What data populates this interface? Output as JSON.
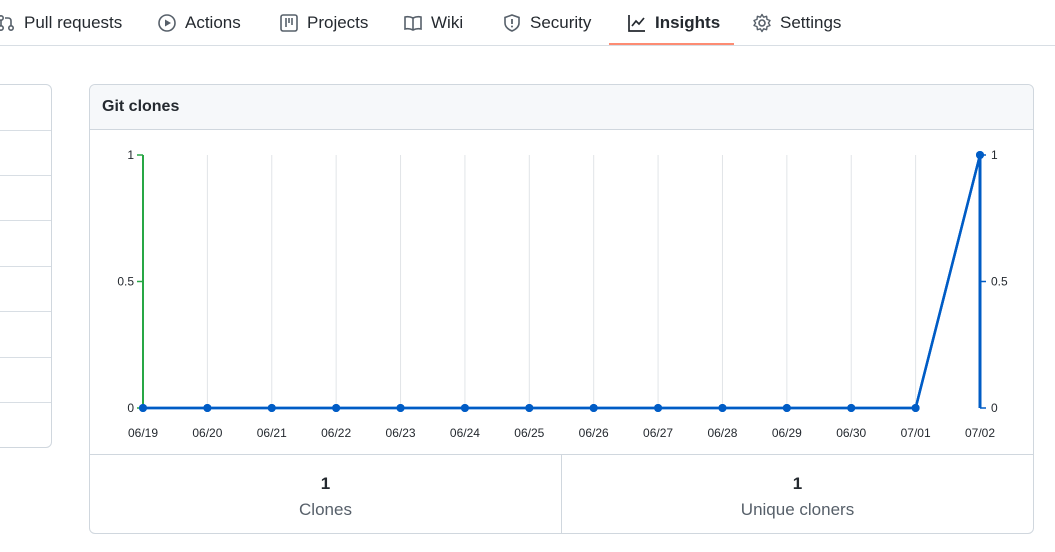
{
  "nav": {
    "tabs": [
      {
        "label": "Pull requests",
        "icon": "pull-request-icon"
      },
      {
        "label": "Actions",
        "icon": "play-icon"
      },
      {
        "label": "Projects",
        "icon": "project-board-icon"
      },
      {
        "label": "Wiki",
        "icon": "book-icon"
      },
      {
        "label": "Security",
        "icon": "shield-icon"
      },
      {
        "label": "Insights",
        "icon": "graph-icon",
        "selected": true
      },
      {
        "label": "Settings",
        "icon": "gear-icon"
      }
    ],
    "underline_color": "#fd8c73"
  },
  "clones_card": {
    "title": "Git clones",
    "stats": [
      {
        "value": "1",
        "label": "Clones"
      },
      {
        "value": "1",
        "label": "Unique cloners"
      }
    ]
  },
  "chart_data": {
    "type": "line",
    "categories": [
      "06/19",
      "06/20",
      "06/21",
      "06/22",
      "06/23",
      "06/24",
      "06/25",
      "06/26",
      "06/27",
      "06/28",
      "06/29",
      "06/30",
      "07/01",
      "07/02"
    ],
    "series": [
      {
        "values": [
          0,
          0,
          0,
          0,
          0,
          0,
          0,
          0,
          0,
          0,
          0,
          0,
          0,
          1
        ],
        "color": "#0366d6",
        "axis": "right"
      },
      {
        "values": [
          0,
          0,
          0,
          0,
          0,
          0,
          0,
          0,
          0,
          0,
          0,
          0,
          0,
          1
        ],
        "color": "#005cc5",
        "axis": "left"
      }
    ],
    "left_axis": {
      "ticks": [
        "0",
        "0.5",
        "1"
      ],
      "color": "#28a745"
    },
    "right_axis": {
      "ticks": [
        "0",
        "0.5",
        "1"
      ],
      "color": "#005cc5"
    },
    "ylim": [
      0,
      1
    ],
    "grid": true
  }
}
